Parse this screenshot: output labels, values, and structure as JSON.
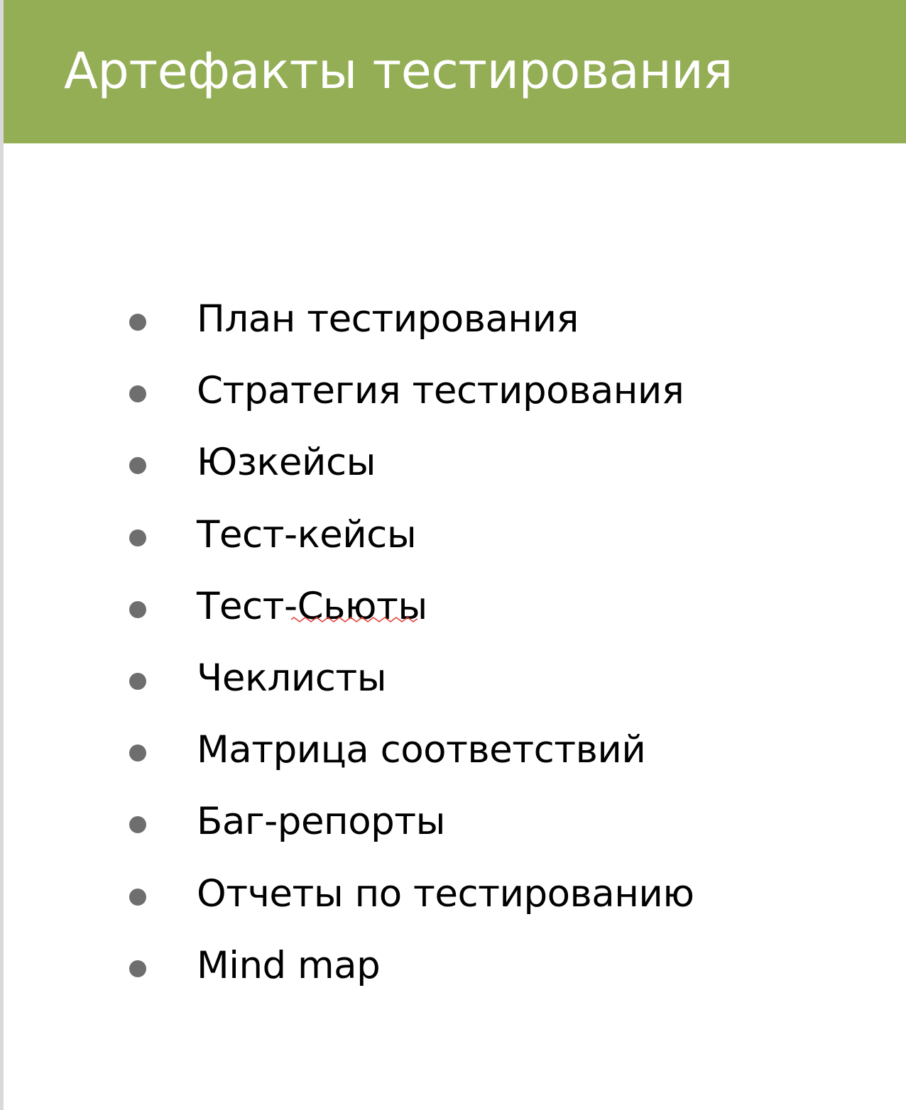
{
  "slide": {
    "title": "Артефакты тестирования",
    "accent_color": "#94ae56",
    "bullet_color": "#6e6e6e",
    "items": [
      "План тестирования",
      "Стратегия тестирования",
      "Юзкейсы",
      "Тест-кейсы",
      "Тест-Сьюты",
      "Чеклисты",
      "Матрица соответствий",
      "Баг-репорты",
      "Отчеты по тестированию",
      "Mind map"
    ]
  }
}
